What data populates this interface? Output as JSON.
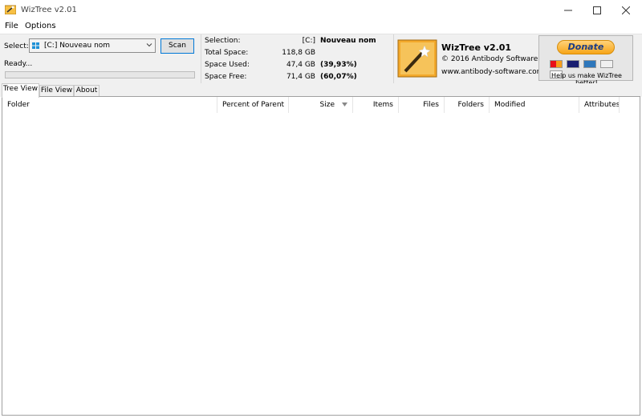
{
  "window": {
    "title": "WizTree v2.01"
  },
  "menu": {
    "file": "File",
    "options": "Options"
  },
  "toolbar": {
    "select_label": "Select:",
    "drive_value": "[C:] Nouveau nom",
    "scan_label": "Scan",
    "status": "Ready...",
    "progress": 0
  },
  "info": {
    "selection_label": "Selection:",
    "selection_drive": "[C:]",
    "selection_name": "Nouveau nom",
    "total_label": "Total Space:",
    "total_value": "118,8 GB",
    "used_label": "Space Used:",
    "used_value": "47,4 GB",
    "used_pct": "(39,93%)",
    "free_label": "Space Free:",
    "free_value": "71,4 GB",
    "free_pct": "(60,07%)"
  },
  "brand": {
    "title": "WizTree v2.01",
    "copyright": "© 2016 Antibody Software",
    "url": "www.antibody-software.com"
  },
  "donate": {
    "button_label": "Donate",
    "tagline": "Help us make WizTree better!",
    "card_names": [
      "mastercard-icon",
      "visa-icon",
      "amex-icon",
      "discover-icon",
      "bank-icon"
    ]
  },
  "tabs": [
    {
      "label": "Tree View",
      "active": true
    },
    {
      "label": "File View",
      "active": false
    },
    {
      "label": "About",
      "active": false
    }
  ],
  "columns": [
    "Folder",
    "Percent of Parent",
    "Size",
    "Items",
    "Files",
    "Folders",
    "Modified",
    "Attributes"
  ],
  "colors": {
    "accent_border": "#0078d7",
    "donate_text": "#1a3c86",
    "donate_fill": "#f7a518"
  }
}
